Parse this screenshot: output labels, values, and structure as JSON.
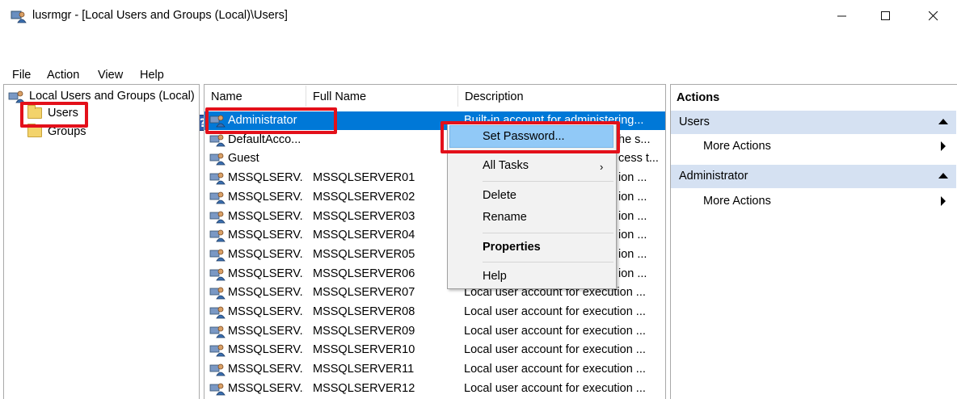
{
  "window": {
    "title": "lusrmgr - [Local Users and Groups (Local)\\Users]"
  },
  "menu": [
    "File",
    "Action",
    "View",
    "Help"
  ],
  "tree": {
    "root": "Local Users and Groups (Local)",
    "items": [
      "Users",
      "Groups"
    ]
  },
  "list": {
    "columns": [
      "Name",
      "Full Name",
      "Description"
    ],
    "rows": [
      {
        "name": "Administrator",
        "full_name": "",
        "description": "Built-in account for administering..."
      },
      {
        "name": "DefaultAcco...",
        "full_name": "",
        "description": "he s..."
      },
      {
        "name": "Guest",
        "full_name": "",
        "description": "cess t..."
      },
      {
        "name": "MSSQLSERV...",
        "full_name": "MSSQLSERVER01",
        "description": "ion ..."
      },
      {
        "name": "MSSQLSERV...",
        "full_name": "MSSQLSERVER02",
        "description": "ion ..."
      },
      {
        "name": "MSSQLSERV...",
        "full_name": "MSSQLSERVER03",
        "description": "ion ..."
      },
      {
        "name": "MSSQLSERV...",
        "full_name": "MSSQLSERVER04",
        "description": "ion ..."
      },
      {
        "name": "MSSQLSERV...",
        "full_name": "MSSQLSERVER05",
        "description": "ion ..."
      },
      {
        "name": "MSSQLSERV...",
        "full_name": "MSSQLSERVER06",
        "description": "ion ..."
      },
      {
        "name": "MSSQLSERV...",
        "full_name": "MSSQLSERVER07",
        "description": "Local user account for execution ..."
      },
      {
        "name": "MSSQLSERV...",
        "full_name": "MSSQLSERVER08",
        "description": "Local user account for execution ..."
      },
      {
        "name": "MSSQLSERV...",
        "full_name": "MSSQLSERVER09",
        "description": "Local user account for execution ..."
      },
      {
        "name": "MSSQLSERV...",
        "full_name": "MSSQLSERVER10",
        "description": "Local user account for execution ..."
      },
      {
        "name": "MSSQLSERV...",
        "full_name": "MSSQLSERVER11",
        "description": "Local user account for execution ..."
      },
      {
        "name": "MSSQLSERV...",
        "full_name": "MSSQLSERVER12",
        "description": "Local user account for execution ..."
      }
    ]
  },
  "context_menu": {
    "items": [
      "Set Password...",
      "All Tasks",
      "Delete",
      "Rename",
      "Properties",
      "Help"
    ]
  },
  "actions": {
    "title": "Actions",
    "sections": [
      {
        "header": "Users",
        "item": "More Actions"
      },
      {
        "header": "Administrator",
        "item": "More Actions"
      }
    ]
  },
  "colors": {
    "selection": "#0078d7",
    "highlight_box": "#e3101a",
    "actions_header": "#d5e1f2",
    "context_highlight": "#91c9f7"
  }
}
